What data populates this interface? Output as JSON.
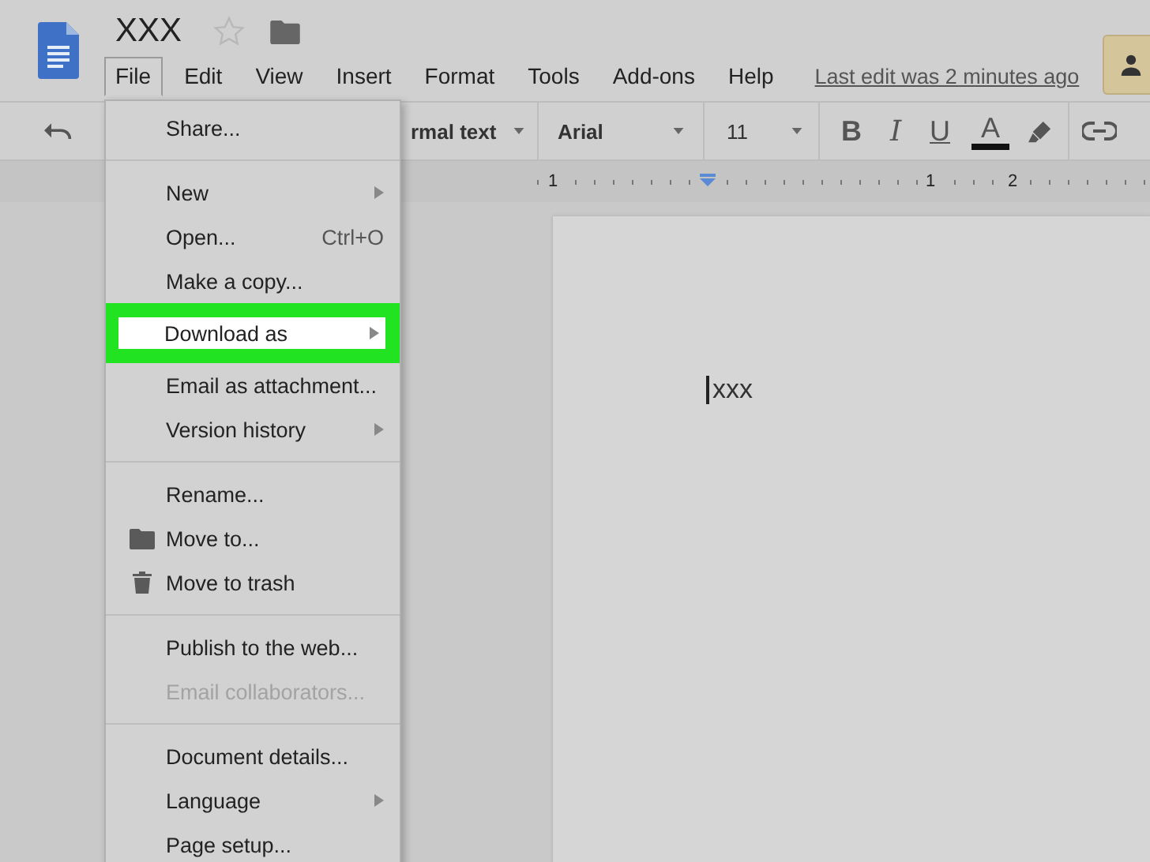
{
  "header": {
    "title": "XXX",
    "starred": false,
    "last_edit": "Last edit was 2 minutes ago"
  },
  "menubar": [
    {
      "label": "File",
      "selected": true
    },
    {
      "label": "Edit",
      "selected": false
    },
    {
      "label": "View",
      "selected": false
    },
    {
      "label": "Insert",
      "selected": false
    },
    {
      "label": "Format",
      "selected": false
    },
    {
      "label": "Tools",
      "selected": false
    },
    {
      "label": "Add-ons",
      "selected": false
    },
    {
      "label": "Help",
      "selected": false
    }
  ],
  "toolbar": {
    "style": "rmal text",
    "font": "Arial",
    "size": "11",
    "format_buttons": [
      "B",
      "I",
      "U",
      "A"
    ]
  },
  "ruler": {
    "labels": [
      "1",
      "1",
      "2"
    ]
  },
  "document": {
    "text": "xxx"
  },
  "file_menu": {
    "sections": [
      [
        {
          "label": "Share...",
          "submenu": false,
          "disabled": false,
          "selected": false
        }
      ],
      [
        {
          "label": "New",
          "submenu": true,
          "disabled": false,
          "selected": false
        },
        {
          "label": "Open...",
          "shortcut": "Ctrl+O",
          "submenu": false,
          "disabled": false,
          "selected": false
        },
        {
          "label": "Make a copy...",
          "submenu": false,
          "disabled": false,
          "selected": false
        },
        {
          "label": "Download as",
          "submenu": true,
          "disabled": false,
          "selected": true
        },
        {
          "label": "Email as attachment...",
          "submenu": false,
          "disabled": false,
          "selected": false
        },
        {
          "label": "Version history",
          "submenu": true,
          "disabled": false,
          "selected": false
        }
      ],
      [
        {
          "label": "Rename...",
          "submenu": false,
          "disabled": false,
          "selected": false
        },
        {
          "label": "Move to...",
          "kind": "folder",
          "submenu": false,
          "disabled": false,
          "selected": false
        },
        {
          "label": "Move to trash",
          "kind": "trash",
          "submenu": false,
          "disabled": false,
          "selected": false
        }
      ],
      [
        {
          "label": "Publish to the web...",
          "submenu": false,
          "disabled": false,
          "selected": false
        },
        {
          "label": "Email collaborators...",
          "submenu": false,
          "disabled": true,
          "selected": false
        }
      ],
      [
        {
          "label": "Document details...",
          "submenu": false,
          "disabled": false,
          "selected": false
        },
        {
          "label": "Language",
          "submenu": true,
          "disabled": false,
          "selected": false
        },
        {
          "label": "Page setup...",
          "submenu": false,
          "disabled": false,
          "selected": false
        }
      ]
    ]
  }
}
